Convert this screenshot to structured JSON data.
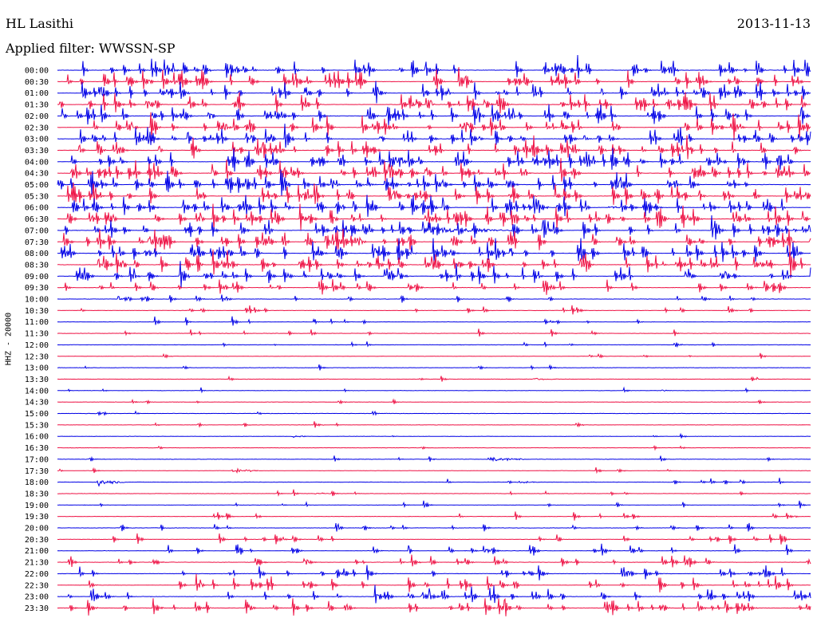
{
  "header": {
    "station": "HL Lasithi",
    "date": "2013-11-13",
    "filter": "Applied filter: WWSSN-SP",
    "channel": "HHZ - 20000"
  },
  "colors": {
    "odd": "#0000e6",
    "even": "#ee1144"
  },
  "chart_data": {
    "type": "helicorder",
    "title": "HL Lasithi",
    "date": "2013-11-13",
    "filter": "WWSSN-SP",
    "ylabel": "HHZ - 20000",
    "row_labels": [
      "00:00",
      "00:30",
      "01:00",
      "01:30",
      "02:00",
      "02:30",
      "03:00",
      "03:30",
      "04:00",
      "04:30",
      "05:00",
      "05:30",
      "06:00",
      "06:30",
      "07:00",
      "07:30",
      "08:00",
      "08:30",
      "09:00",
      "09:30",
      "10:00",
      "10:30",
      "11:00",
      "11:30",
      "12:00",
      "12:30",
      "13:00",
      "13:30",
      "14:00",
      "14:30",
      "15:00",
      "15:30",
      "16:00",
      "16:30",
      "17:00",
      "17:30",
      "18:00",
      "18:30",
      "19:00",
      "19:30",
      "20:00",
      "20:30",
      "21:00",
      "21:30",
      "22:00",
      "22:30",
      "23:00",
      "23:30"
    ],
    "row_colors": [
      "blue",
      "red"
    ],
    "activity_level": [
      0.95,
      0.95,
      0.95,
      0.95,
      0.95,
      0.95,
      0.95,
      0.95,
      1.0,
      1.0,
      1.0,
      1.0,
      1.0,
      1.0,
      1.0,
      1.0,
      1.0,
      1.0,
      0.95,
      0.75,
      0.55,
      0.5,
      0.45,
      0.4,
      0.35,
      0.3,
      0.3,
      0.3,
      0.3,
      0.3,
      0.3,
      0.3,
      0.25,
      0.25,
      0.3,
      0.3,
      0.35,
      0.35,
      0.4,
      0.45,
      0.5,
      0.55,
      0.6,
      0.65,
      0.7,
      0.75,
      0.8,
      0.85
    ],
    "events": [
      {
        "row": "03:00",
        "x_fraction": 0.17,
        "width_fraction": 0.02,
        "amplitude": 0.5
      },
      {
        "row": "05:00",
        "x_fraction": 0.4,
        "width_fraction": 0.02,
        "amplitude": 0.5
      },
      {
        "row": "05:00",
        "x_fraction": 0.59,
        "width_fraction": 0.02,
        "amplitude": 0.5
      },
      {
        "row": "06:00",
        "x_fraction": 0.73,
        "width_fraction": 0.02,
        "amplitude": 0.6
      },
      {
        "row": "07:00",
        "x_fraction": 0.49,
        "width_fraction": 0.12,
        "amplitude": 1.0
      },
      {
        "row": "08:30",
        "x_fraction": 0.82,
        "width_fraction": 0.04,
        "amplitude": 0.5
      },
      {
        "row": "13:30",
        "x_fraction": 0.63,
        "width_fraction": 0.04,
        "amplitude": 0.3
      },
      {
        "row": "14:00",
        "x_fraction": 0.8,
        "width_fraction": 0.02,
        "amplitude": 0.3
      },
      {
        "row": "16:00",
        "x_fraction": 0.31,
        "width_fraction": 0.02,
        "amplitude": 0.5
      },
      {
        "row": "17:00",
        "x_fraction": 0.57,
        "width_fraction": 0.05,
        "amplitude": 1.0
      },
      {
        "row": "17:30",
        "x_fraction": 0.23,
        "width_fraction": 0.04,
        "amplitude": 0.6
      },
      {
        "row": "18:00",
        "x_fraction": 0.05,
        "width_fraction": 0.04,
        "amplitude": 1.0
      },
      {
        "row": "18:00",
        "x_fraction": 0.61,
        "width_fraction": 0.03,
        "amplitude": 0.6
      },
      {
        "row": "18:30",
        "x_fraction": 0.34,
        "width_fraction": 0.02,
        "amplitude": 0.5
      }
    ]
  }
}
